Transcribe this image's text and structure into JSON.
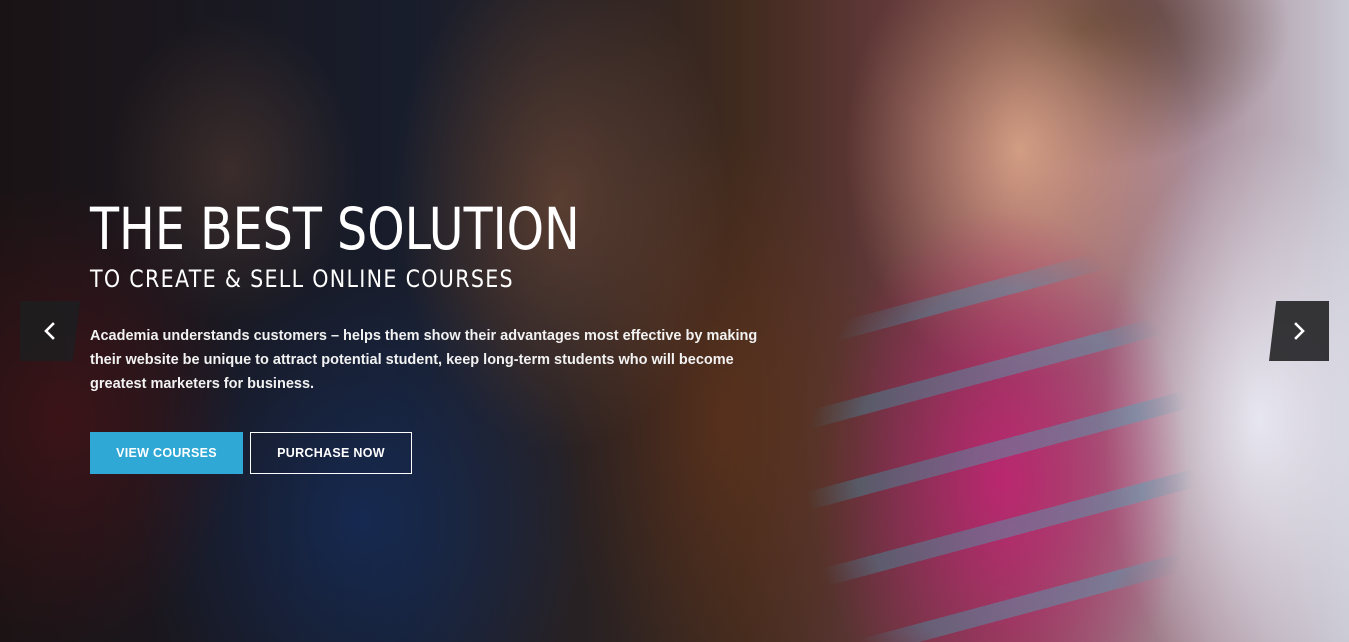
{
  "slider": {
    "headline": "THE BEST SOLUTION",
    "subheadline": "TO CREATE & SELL ONLINE COURSES",
    "description": "Academia understands customers – helps them show their advantages most effective by making their website be unique to attract potential student, keep long-term students who will become greatest marketers for business.",
    "primary_button": "VIEW COURSES",
    "secondary_button": "PURCHASE NOW",
    "prev_icon": "chevron-left-icon",
    "next_icon": "chevron-right-icon"
  },
  "colors": {
    "accent": "#2fa8d5",
    "arrow_bg": "#1e1e20",
    "text": "#ffffff"
  }
}
